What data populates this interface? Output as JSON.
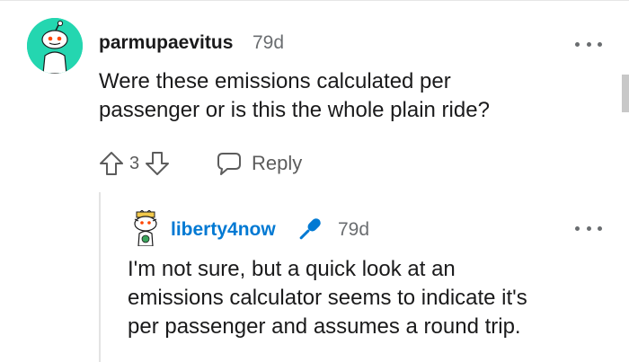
{
  "comment": {
    "author": "parmupaevitus",
    "age": "79d",
    "body_lines": [
      "Were these emissions calculated per",
      "passenger or is this the whole plain ride?"
    ],
    "score": "3",
    "reply_label": "Reply"
  },
  "reply": {
    "author": "liberty4now",
    "age": "79d",
    "body_lines": [
      "I'm not sure, but a quick look at an",
      "emissions calculator seems to indicate it's",
      "per passenger and assumes a round trip."
    ]
  },
  "icons": {
    "more": "more-icon",
    "upvote": "upvote-icon",
    "downvote": "downvote-icon",
    "reply": "reply-bubble-icon",
    "award": "microphone-icon"
  },
  "colors": {
    "accent": "#0079d3",
    "avatar_bg": "#24d6b0",
    "muted": "#6a6d70"
  }
}
